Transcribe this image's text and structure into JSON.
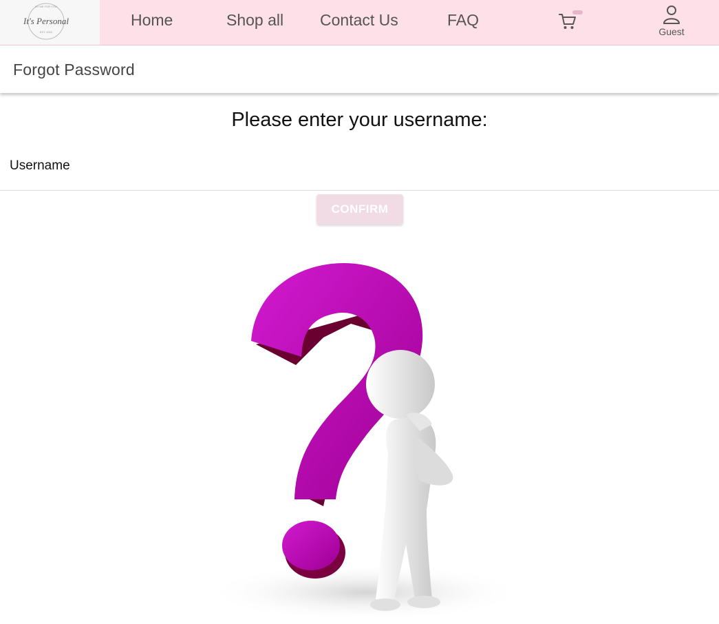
{
  "nav": {
    "logo": {
      "script_text": "It's Personal",
      "ring_text": "BY ME FOR YOU",
      "est_text": "EST. 2022"
    },
    "links": [
      {
        "label": "Home"
      },
      {
        "label": "Shop all"
      },
      {
        "label": "Contact Us"
      },
      {
        "label": "FAQ"
      }
    ],
    "cart_icon": "cart-icon",
    "user": {
      "icon": "user-icon",
      "label": "Guest"
    },
    "background_color": "#fde0e8"
  },
  "page": {
    "title": "Forgot Password",
    "prompt": "Please enter your username:",
    "username_field": {
      "label": "Username",
      "value": ""
    },
    "confirm_button": {
      "label": "CONFIRM",
      "color": "#f1dce6"
    }
  },
  "illustration": {
    "description_icon": "question-mark-figure",
    "accent_color": "#c000b0"
  }
}
